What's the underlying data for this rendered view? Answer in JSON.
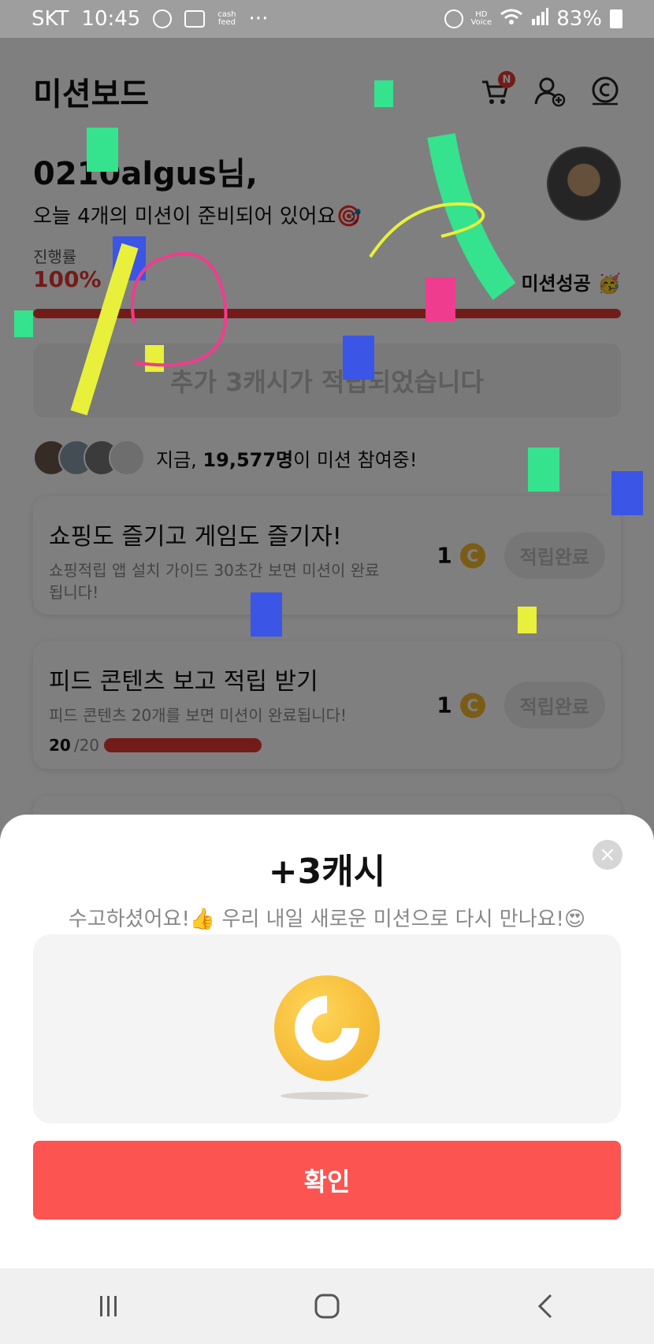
{
  "status_bar": {
    "carrier": "SKT",
    "time": "10:45",
    "cash_feed": "cash\nfeed",
    "dots": "···",
    "hd_voice": "HD\nVoice",
    "battery": "83%"
  },
  "header": {
    "title": "미션보드",
    "cart_badge": "N",
    "icons": [
      "cart-icon",
      "add-friend-icon",
      "cash-icon"
    ]
  },
  "greeting": {
    "name": "0210algus님,",
    "subtitle": "오늘 4개의 미션이 준비되어 있어요🎯"
  },
  "progress": {
    "label": "진행률",
    "value": "100%",
    "fill_fraction": 1.0,
    "success_text": "미션성공 🥳"
  },
  "banner": {
    "text": "추가 3캐시가 적립되었습니다"
  },
  "participants": {
    "prefix": "지금, ",
    "count": "19,577명",
    "suffix": "이 미션 참여중!"
  },
  "missions": [
    {
      "title": "쇼핑도 즐기고 게임도 즐기자!",
      "desc": "쇼핑적립 앱 설치 가이드 30초간 보면 미션이 완료됩니다!",
      "reward": "1",
      "status": "적립완료"
    },
    {
      "title": "피드 콘텐츠 보고 적립 받기",
      "desc": "피드 콘텐츠 20개를 보면 미션이 완료됩니다!",
      "reward": "1",
      "status": "적립완료",
      "progress_done": "20",
      "progress_total": "/20"
    }
  ],
  "sheet": {
    "title": "+3캐시",
    "subtitle": "수고하셨어요!👍 우리 내일 새로운 미션으로 다시 만나요!😍",
    "confirm": "확인",
    "close": "×"
  },
  "colors": {
    "accent": "#fb5451",
    "progress": "#e53935",
    "coin": "#f4b731"
  }
}
